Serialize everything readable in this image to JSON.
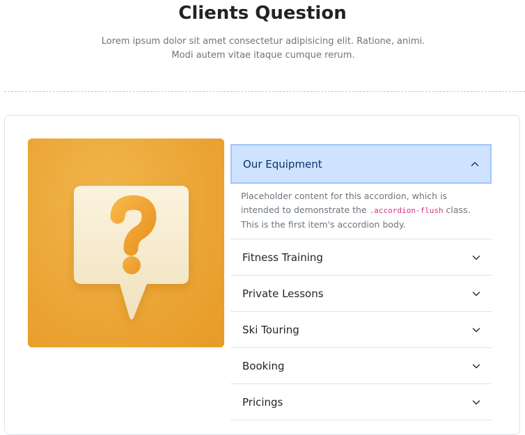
{
  "header": {
    "title": "Clients Question",
    "subtitle": "Lorem ipsum dolor sit amet consectetur adipisicing elit. Ratione, animi. Modi autem vitae itaque cumque rerum."
  },
  "image": {
    "icon": "question-bubble-icon",
    "colors": {
      "background": "#eba636",
      "bubble": "#f6ead0",
      "question_mark": "#f0a52c"
    }
  },
  "accordion": {
    "items": [
      {
        "label": "Our Equipment",
        "expanded": true,
        "body": {
          "before": "Placeholder content for this accordion, which is intended to demonstrate the ",
          "code": ".accordion-flush",
          "after": " class. This is the first item's accordion body."
        }
      },
      {
        "label": "Fitness Training",
        "expanded": false
      },
      {
        "label": "Private Lessons",
        "expanded": false
      },
      {
        "label": "Ski Touring",
        "expanded": false
      },
      {
        "label": "Booking",
        "expanded": false
      },
      {
        "label": "Pricings",
        "expanded": false
      }
    ],
    "colors": {
      "active_background": "#cfe2ff",
      "active_border": "#9ec5fe",
      "active_text": "#0a2f6b",
      "code_text": "#d63384"
    }
  }
}
